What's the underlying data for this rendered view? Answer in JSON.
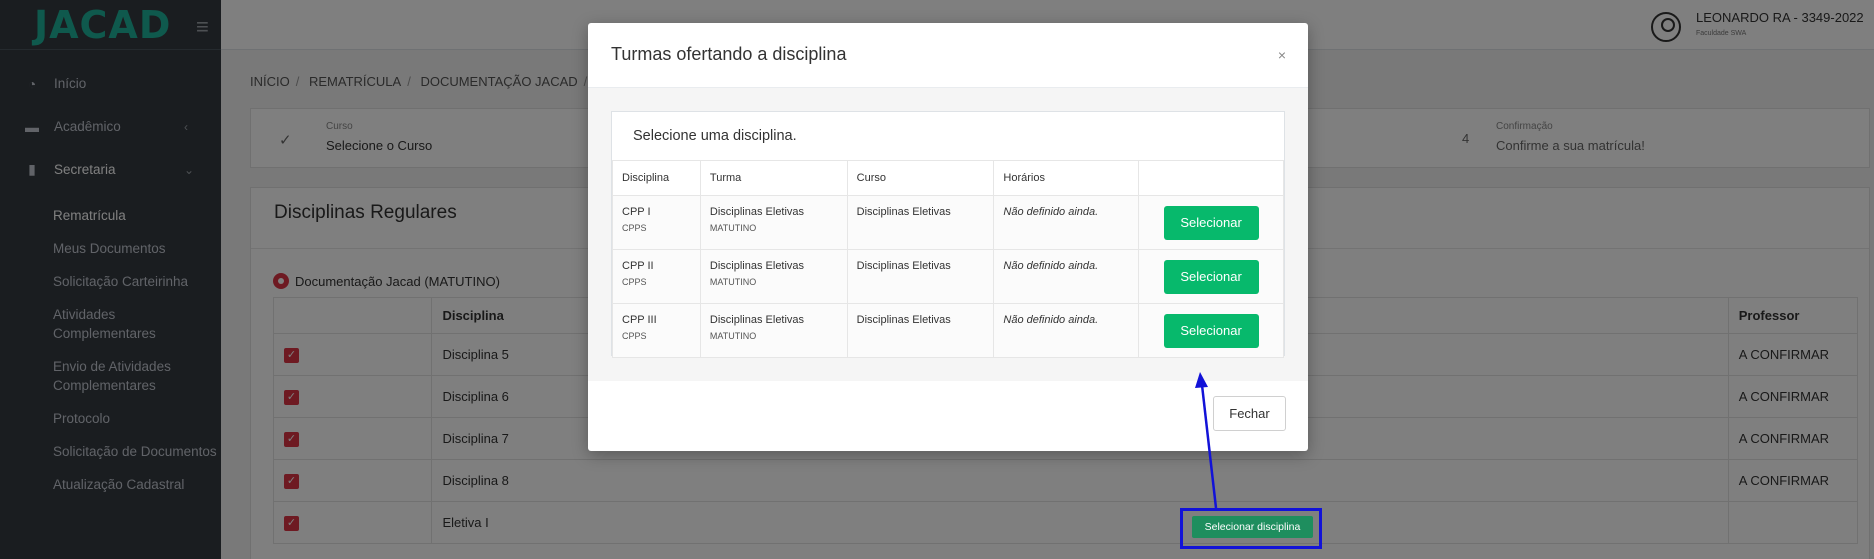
{
  "brand": {
    "logo": "JACAD"
  },
  "sidebar": {
    "items": [
      {
        "label": "Início"
      },
      {
        "label": "Acadêmico"
      },
      {
        "label": "Secretaria"
      }
    ],
    "subitems": [
      {
        "label": "Rematrícula"
      },
      {
        "label": "Meus Documentos"
      },
      {
        "label": "Solicitação Carteirinha"
      },
      {
        "label": "Atividades Complementares"
      },
      {
        "label": "Envio de Atividades Complementares"
      },
      {
        "label": "Protocolo"
      },
      {
        "label": "Solicitação de Documentos"
      },
      {
        "label": "Atualização Cadastral"
      }
    ]
  },
  "header": {
    "user_name": "LEONARDO RA - 3349-2022",
    "user_sub": "Faculdade SWA"
  },
  "breadcrumb": [
    "INÍCIO",
    "REMATRÍCULA",
    "DOCUMENTAÇÃO JACAD"
  ],
  "steps": {
    "step1_label": "Curso",
    "step1_value": "Selecione o Curso",
    "step4_number": "4",
    "step4_label": "Confirmação",
    "step4_value": "Confirme a sua matrícula!"
  },
  "card": {
    "title": "Disciplinas Regulares",
    "group": "Documentação Jacad (MATUTINO)",
    "col_disciplina": "Disciplina",
    "col_professor": "Professor",
    "rows": [
      {
        "name": "Disciplina 5",
        "professor": "A CONFIRMAR"
      },
      {
        "name": "Disciplina 6",
        "professor": "A CONFIRMAR"
      },
      {
        "name": "Disciplina 7",
        "professor": "A CONFIRMAR"
      },
      {
        "name": "Disciplina 8",
        "professor": "A CONFIRMAR"
      },
      {
        "name": "Eletiva I",
        "professor": ""
      }
    ],
    "select_discipline_button": "Selecionar disciplina"
  },
  "modal": {
    "title": "Turmas ofertando a disciplina",
    "close_glyph": "×",
    "inner_title": "Selecione uma disciplina.",
    "headers": [
      "Disciplina",
      "Turma",
      "Curso",
      "Horários",
      ""
    ],
    "rows": [
      {
        "disciplina": "CPP I",
        "disciplina_sub": "CPPS",
        "turma": "Disciplinas Eletivas",
        "turma_sub": "MATUTINO",
        "curso": "Disciplinas Eletivas",
        "horarios": "Não definido ainda.",
        "action": "Selecionar"
      },
      {
        "disciplina": "CPP II",
        "disciplina_sub": "CPPS",
        "turma": "Disciplinas Eletivas",
        "turma_sub": "MATUTINO",
        "curso": "Disciplinas Eletivas",
        "horarios": "Não definido ainda.",
        "action": "Selecionar"
      },
      {
        "disciplina": "CPP III",
        "disciplina_sub": "CPPS",
        "turma": "Disciplinas Eletivas",
        "turma_sub": "MATUTINO",
        "curso": "Disciplinas Eletivas",
        "horarios": "Não definido ainda.",
        "action": "Selecionar"
      }
    ],
    "footer_button": "Fechar"
  },
  "colors": {
    "brand": "#1fb39a",
    "select_button": "#07b96c",
    "highlight": "#1212d8",
    "checkbox": "#dc3545"
  }
}
